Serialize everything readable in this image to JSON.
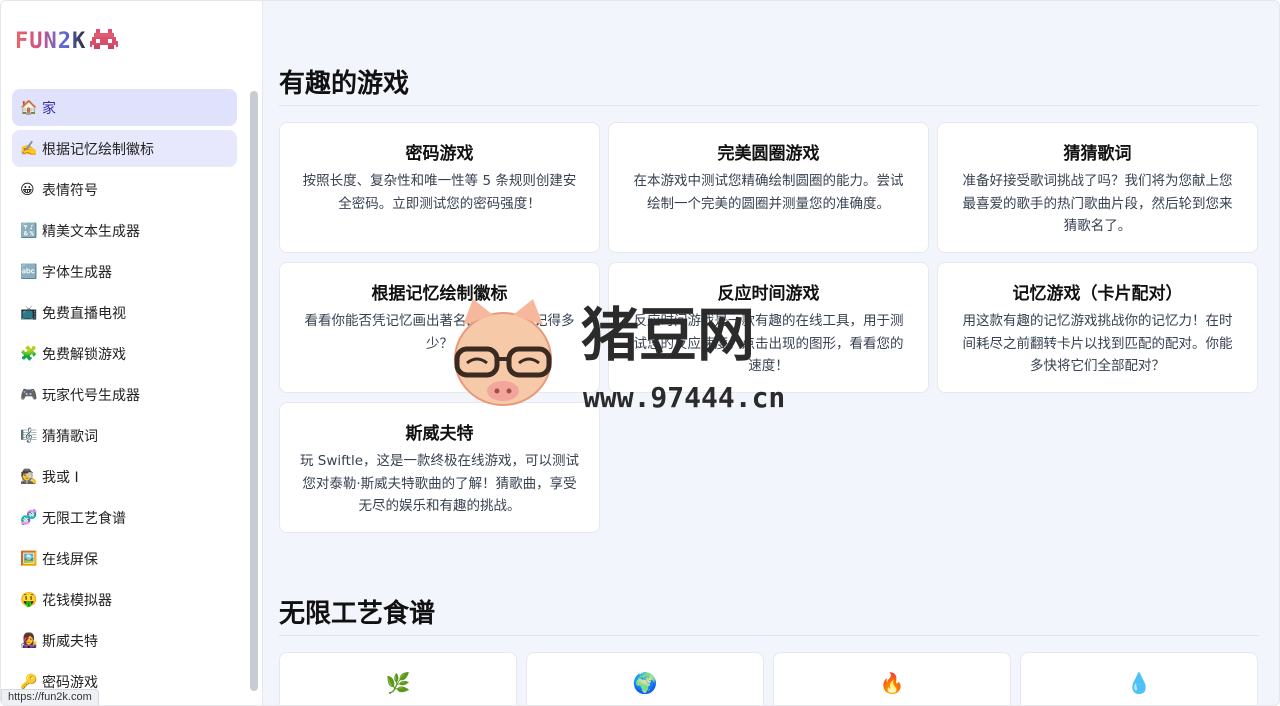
{
  "logo": {
    "text": "FUN2K"
  },
  "nav": [
    {
      "icon": "🏠",
      "label": "家"
    },
    {
      "icon": "✍️",
      "label": "根据记忆绘制徽标"
    },
    {
      "icon": "😀",
      "label": "表情符号"
    },
    {
      "icon": "🔣",
      "label": "精美文本生成器"
    },
    {
      "icon": "🔤",
      "label": "字体生成器"
    },
    {
      "icon": "📺",
      "label": "免费直播电视"
    },
    {
      "icon": "🧩",
      "label": "免费解锁游戏"
    },
    {
      "icon": "🎮",
      "label": "玩家代号生成器"
    },
    {
      "icon": "🎼",
      "label": "猜猜歌词"
    },
    {
      "icon": "🕵️",
      "label": "我或 I"
    },
    {
      "icon": "🧬",
      "label": "无限工艺食谱"
    },
    {
      "icon": "🖼️",
      "label": "在线屏保"
    },
    {
      "icon": "🤑",
      "label": "花钱模拟器"
    },
    {
      "icon": "👩‍🎤",
      "label": "斯威夫特"
    },
    {
      "icon": "🔑",
      "label": "密码游戏"
    }
  ],
  "status_url": "https://fun2k.com",
  "sections": {
    "games": {
      "title": "有趣的游戏",
      "cards": [
        {
          "title": "密码游戏",
          "desc": "按照长度、复杂性和唯一性等 5 条规则创建安全密码。立即测试您的密码强度！"
        },
        {
          "title": "完美圆圈游戏",
          "desc": "在本游戏中测试您精确绘制圆圈的能力。尝试绘制一个完美的圆圈并测量您的准确度。"
        },
        {
          "title": "猜猜歌词",
          "desc": "准备好接受歌词挑战了吗？我们将为您献上您最喜爱的歌手的热门歌曲片段，然后轮到您来猜歌名了。"
        },
        {
          "title": "根据记忆绘制徽标",
          "desc": "看看你能否凭记忆画出著名的标志。你记得多少？"
        },
        {
          "title": "反应时间游戏",
          "desc": "反应时间游戏是一款有趣的在线工具，用于测试您的反应速度。点击出现的图形，看看您的速度！"
        },
        {
          "title": "记忆游戏（卡片配对）",
          "desc": "用这款有趣的记忆游戏挑战你的记忆力！在时间耗尽之前翻转卡片以找到匹配的配对。你能多快将它们全部配对？"
        },
        {
          "title": "斯威夫特",
          "desc": "玩 Swiftle，这是一款终极在线游戏，可以测试您对泰勒·斯威夫特歌曲的了解！猜歌曲，享受无尽的娱乐和有趣的挑战。"
        }
      ]
    },
    "recipes": {
      "title": "无限工艺食谱",
      "cards": [
        {
          "icon": "🌿"
        },
        {
          "icon": "🌍"
        },
        {
          "icon": "🔥"
        },
        {
          "icon": "💧"
        }
      ]
    }
  },
  "watermark": {
    "text_cn": "猪豆网",
    "url": "www.97444.cn"
  }
}
